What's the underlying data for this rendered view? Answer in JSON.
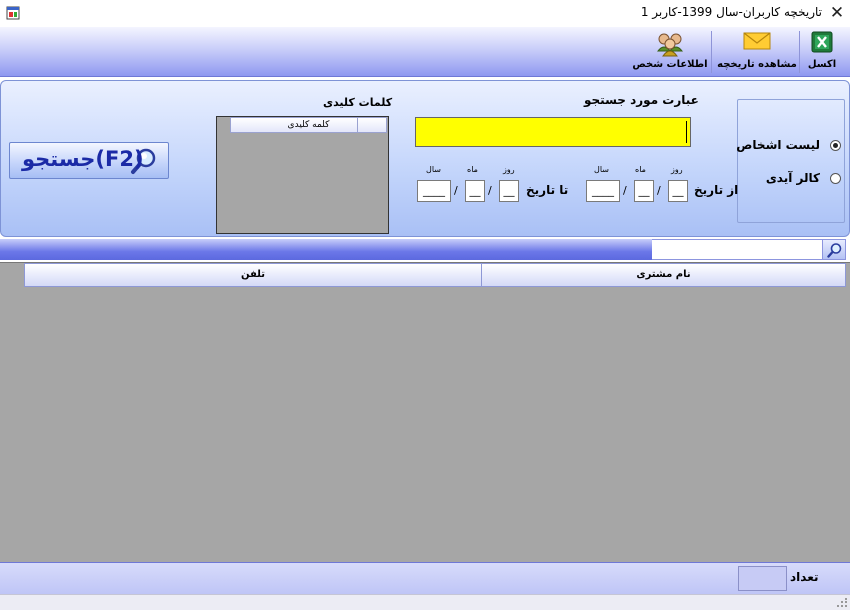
{
  "window": {
    "title": "تاریخچه کاربران-سال 1399-کاربر 1",
    "close_glyph": "✕",
    "app_icon": "app-window-icon"
  },
  "toolbar": {
    "excel_label": "اکسل",
    "history_label": "مشاهده تاریخچه",
    "person_info_label": "اطلاعات شخص",
    "icons": {
      "excel": "excel-icon",
      "history": "envelope-icon",
      "person": "people-icon"
    }
  },
  "search": {
    "query_label": "عبارت مورد جستجو",
    "query_value": "",
    "keywords_label": "کلمات کلیدی",
    "keyword_column": "کلمه کلیدی",
    "from_date_label": "از تاریخ",
    "to_date_label": "تا تاریخ",
    "day_label": "روز",
    "month_label": "ماه",
    "year_label": "سال",
    "from_date": {
      "day": "__",
      "month": "__",
      "year": "____"
    },
    "to_date": {
      "day": "__",
      "month": "__",
      "year": "____"
    },
    "radio_people_list": "لیست اشخاص",
    "radio_caller_id": "کالر آیدی",
    "selected_radio": "people_list",
    "search_button_label": "جستجو(F2)",
    "search_button_icon": "magnifier-icon"
  },
  "filter": {
    "value": "",
    "icon": "search-icon"
  },
  "grid": {
    "columns": [
      "نام مشتری",
      "تلفن"
    ],
    "rows": []
  },
  "footer": {
    "count_label": "تعداد",
    "count_value": ""
  },
  "colors": {
    "query_background": "#ffff00",
    "grid_background": "#a6a6a6",
    "toolbar_accent": "#8f98f0",
    "button_text": "#1b2aa6"
  }
}
